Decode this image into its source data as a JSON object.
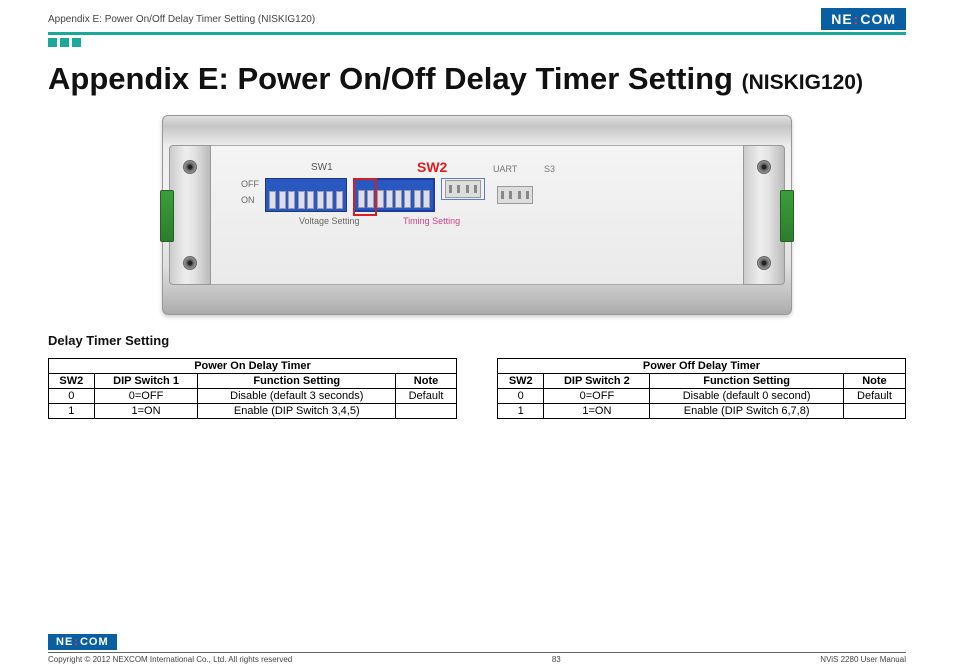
{
  "header": {
    "breadcrumb": "Appendix E: Power On/Off Delay Timer Setting (NISKIG120)",
    "logo_text_left": "NE",
    "logo_text_right": "COM"
  },
  "title": {
    "main": "Appendix E: Power On/Off Delay Timer Setting",
    "part": "(NISKIG120)"
  },
  "device_labels": {
    "sw1": "SW1",
    "sw2": "SW2",
    "uart": "UART",
    "s3": "S3",
    "voltage": "Voltage Setting",
    "timing": "Timing Setting",
    "off": "OFF",
    "on": "ON"
  },
  "section_title": "Delay Timer Setting",
  "table_on": {
    "title": "Power On Delay Timer",
    "headers": [
      "SW2",
      "DIP Switch 1",
      "Function Setting",
      "Note"
    ],
    "rows": [
      [
        "0",
        "0=OFF",
        "Disable (default 3 seconds)",
        "Default"
      ],
      [
        "1",
        "1=ON",
        "Enable (DIP Switch 3,4,5)",
        ""
      ]
    ]
  },
  "table_off": {
    "title": "Power Off Delay Timer",
    "headers": [
      "SW2",
      "DIP Switch 2",
      "Function Setting",
      "Note"
    ],
    "rows": [
      [
        "0",
        "0=OFF",
        "Disable (default 0 second)",
        "Default"
      ],
      [
        "1",
        "1=ON",
        "Enable (DIP Switch 6,7,8)",
        ""
      ]
    ]
  },
  "footer": {
    "copyright": "Copyright © 2012 NEXCOM International Co., Ltd. All rights reserved",
    "page": "83",
    "manual": "NViS 2280 User Manual"
  }
}
